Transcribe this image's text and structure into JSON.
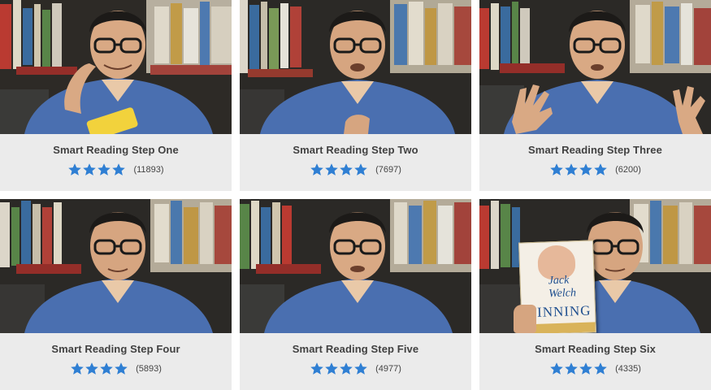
{
  "videos": [
    {
      "title": "Smart Reading Step One",
      "rating": 4,
      "count": "(11893)"
    },
    {
      "title": "Smart Reading Step Two",
      "rating": 4,
      "count": "(7697)"
    },
    {
      "title": "Smart Reading Step Three",
      "rating": 4,
      "count": "(6200)"
    },
    {
      "title": "Smart Reading Step Four",
      "rating": 4,
      "count": "(5893)"
    },
    {
      "title": "Smart Reading Step Five",
      "rating": 4,
      "count": "(4977)"
    },
    {
      "title": "Smart Reading Step Six",
      "rating": 4,
      "count": "(4335)"
    }
  ],
  "book_on_step_six": {
    "line1": "Jack",
    "line2": "Welch",
    "line3": "WINNING"
  },
  "colors": {
    "star": "#2f7fd3",
    "card_bg": "#ebebeb",
    "title": "#414141",
    "shirt": "#4a6fb0"
  },
  "icons": {
    "star": "star-icon"
  }
}
